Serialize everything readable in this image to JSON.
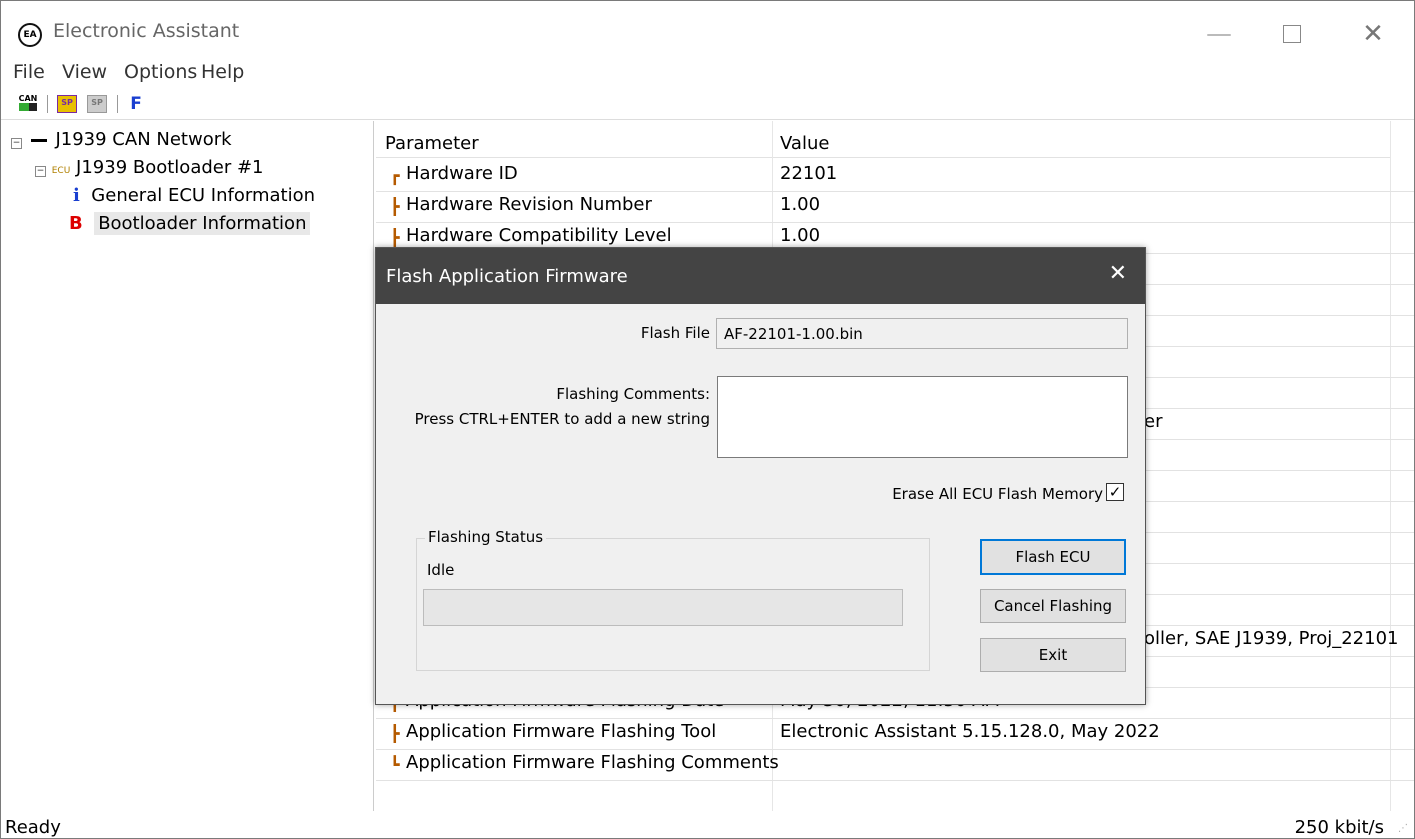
{
  "window": {
    "title": "Electronic Assistant",
    "icon": "EA"
  },
  "menu": [
    "File",
    "View",
    "Options",
    "Help"
  ],
  "toolbar": {
    "can_icon": "CAN",
    "sp_icon": "SP",
    "sp_icon2": "SP",
    "f_label": "F"
  },
  "tree": {
    "network": "J1939 CAN Network",
    "ecu_tag": "ECU",
    "bootloader": "J1939 Bootloader #1",
    "general_icon": "i",
    "general": "General ECU Information",
    "boot_icon": "B",
    "boot": "Bootloader Information"
  },
  "table": {
    "headers": [
      "Parameter",
      "Value"
    ],
    "rows_top": [
      {
        "name": "Hardware ID",
        "value": "22101"
      },
      {
        "name": "Hardware Revision Number",
        "value": "1.00"
      },
      {
        "name": "Hardware Compatibility Level",
        "value": "1.00"
      }
    ],
    "partial_1": "er",
    "partial_2": "oller, SAE J1939, Proj_22101",
    "rows_bottom": [
      {
        "name": "Application Firmware Flashing Date",
        "value": "May 30, 2022, 11:50 AM"
      },
      {
        "name": "Application Firmware Flashing Tool",
        "value": "Electronic Assistant 5.15.128.0, May 2022"
      },
      {
        "name": "Application Firmware Flashing Comments",
        "value": ""
      }
    ]
  },
  "dialog": {
    "title": "Flash Application Firmware",
    "flash_file_label": "Flash File",
    "flash_file_value": "AF-22101-1.00.bin",
    "comments_label": "Flashing Comments:",
    "comments_hint": "Press CTRL+ENTER to add a new string",
    "erase_label": "Erase All ECU Flash Memory",
    "erase_checked": true,
    "status_group": "Flashing Status",
    "status_value": "Idle",
    "progress": 0,
    "flash_button": "Flash ECU",
    "cancel_button": "Cancel Flashing",
    "exit_button": "Exit"
  },
  "statusbar": {
    "left": "Ready",
    "right": "250 kbit/s"
  }
}
